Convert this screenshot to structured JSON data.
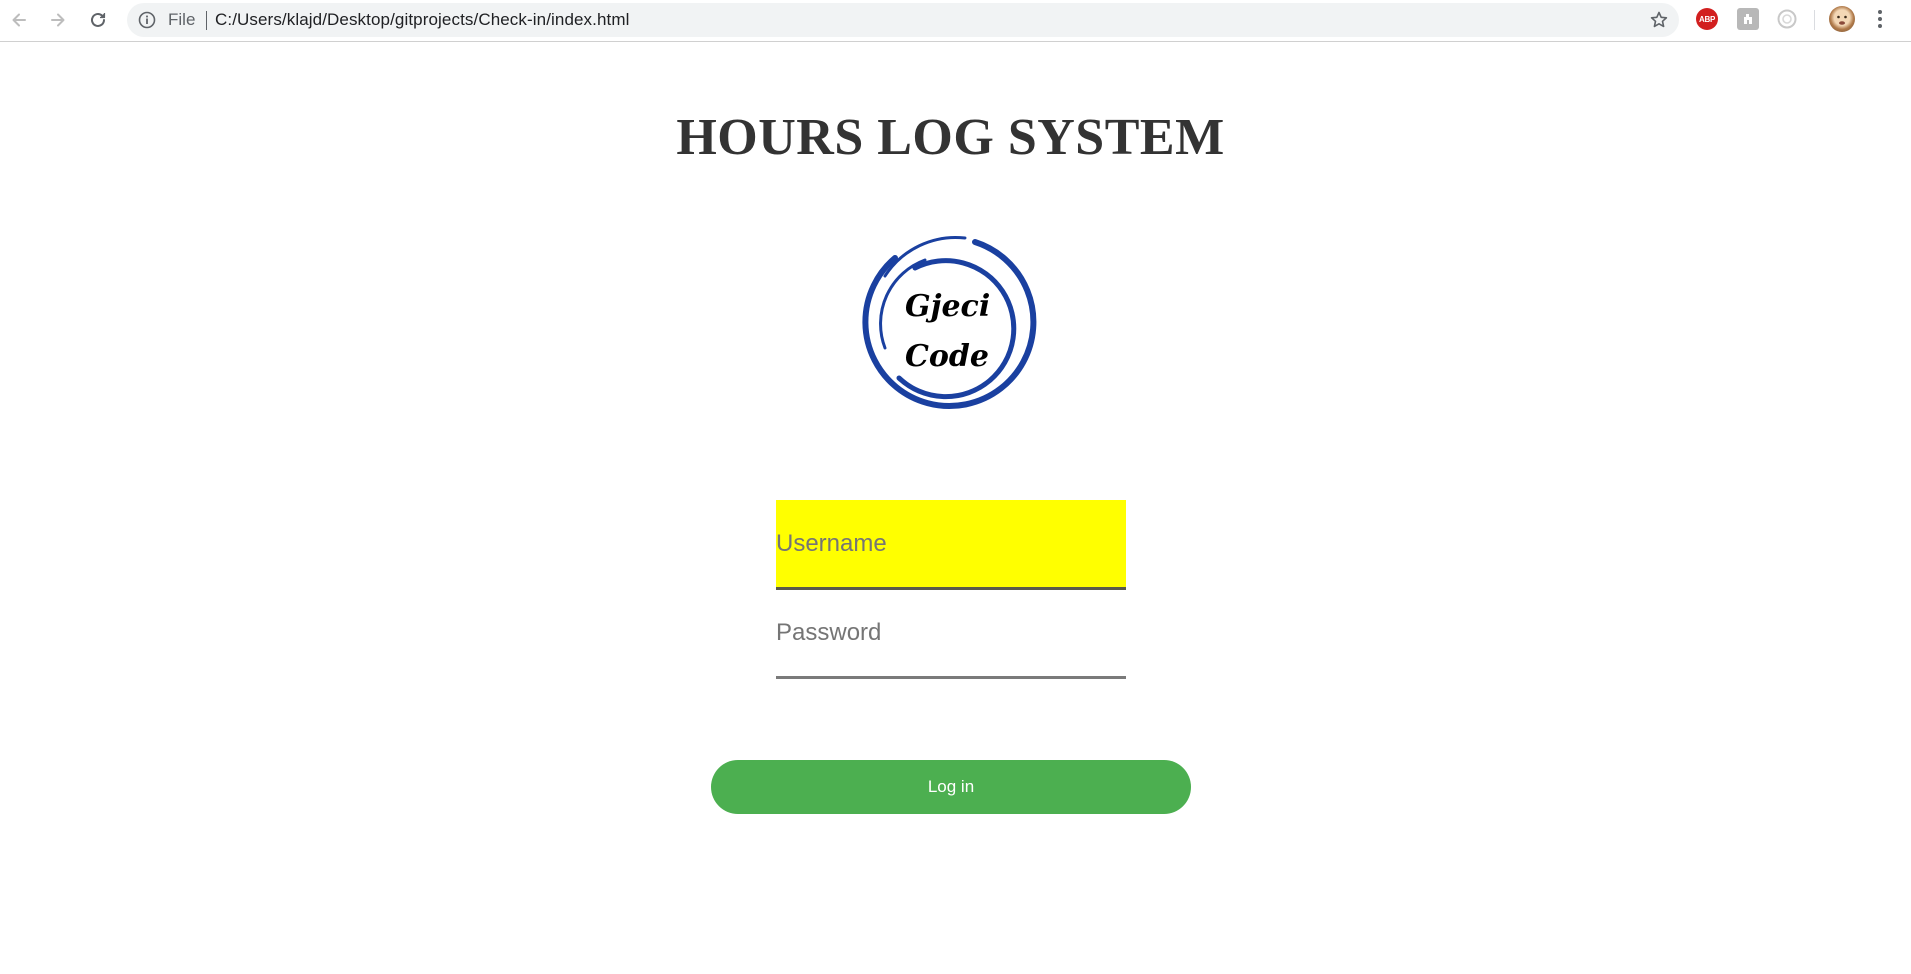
{
  "browser": {
    "scheme_label": "File",
    "url": "C:/Users/klajd/Desktop/gitprojects/Check-in/index.html",
    "extensions": {
      "adblock_label": "ABP"
    }
  },
  "page": {
    "title": "HOURS LOG SYSTEM",
    "logo": {
      "line1": "Gjeci",
      "line2": "Code",
      "ring_color": "#1a40a0"
    },
    "form": {
      "username_placeholder": "Username",
      "password_placeholder": "Password",
      "login_label": "Log in"
    }
  },
  "colors": {
    "login_button": "#4caf50",
    "username_highlight": "#ffff00",
    "title_text": "#333333"
  }
}
